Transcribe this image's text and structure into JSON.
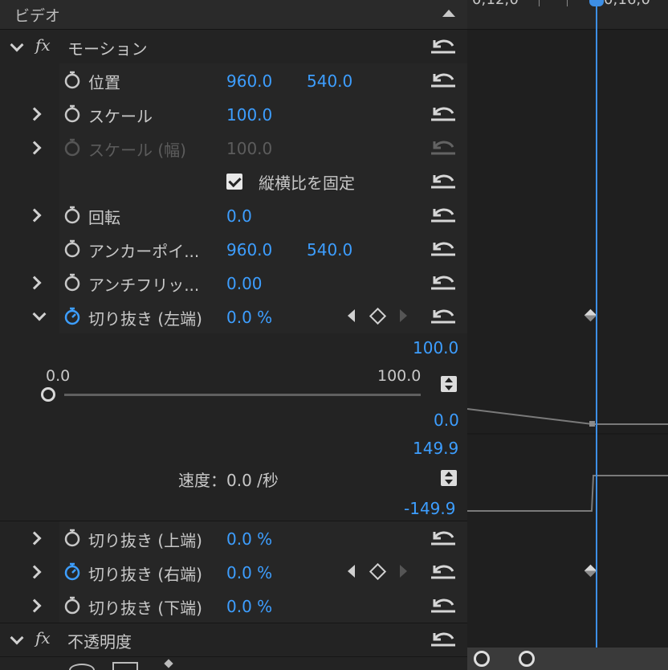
{
  "panel": {
    "section_title": "ビデオ",
    "motion": {
      "fx": "fx",
      "title": "モーション",
      "position": {
        "label": "位置",
        "x": "960.0",
        "y": "540.0"
      },
      "scale": {
        "label": "スケール",
        "value": "100.0"
      },
      "scale_width": {
        "label": "スケール (幅)",
        "value": "100.0"
      },
      "uniform_scale": {
        "label": "縦横比を固定",
        "checked": true
      },
      "rotation": {
        "label": "回転",
        "value": "0.0"
      },
      "anchor": {
        "label": "アンカーポイ...",
        "x": "960.0",
        "y": "540.0"
      },
      "antiflicker": {
        "label": "アンチフリッ...",
        "value": "0.00"
      }
    },
    "crop_left": {
      "label": "切り抜き (左端)",
      "value": "0.0 %",
      "graph": {
        "max": "100.0",
        "min": "0.0",
        "slider_min": "0.0",
        "slider_max": "100.0",
        "slider_value": 0
      },
      "velocity": {
        "max": "149.9",
        "min": "-149.9",
        "text": "速度：0.0 /秒"
      }
    },
    "crop_top": {
      "label": "切り抜き (上端)",
      "value": "0.0 %"
    },
    "crop_right": {
      "label": "切り抜き (右端)",
      "value": "0.0 %"
    },
    "crop_bottom": {
      "label": "切り抜き (下端)",
      "value": "0.0 %"
    },
    "opacity": {
      "fx": "fx",
      "title": "不透明度"
    }
  },
  "timeline": {
    "ruler_text": "0;12;0",
    "ruler_text2": "0;16;0"
  },
  "colors": {
    "accent": "#3d9eff",
    "playhead": "#3d8fe6",
    "panel": "#232323",
    "text": "#c8c8c8"
  },
  "icons": {
    "reset": "reset-icon",
    "stopwatch": "stopwatch-icon",
    "expand": "chevron-right-icon",
    "collapse": "chevron-down-icon",
    "keyframe": "keyframe-diamond-icon",
    "section_collapse": "triangle-up-icon"
  }
}
